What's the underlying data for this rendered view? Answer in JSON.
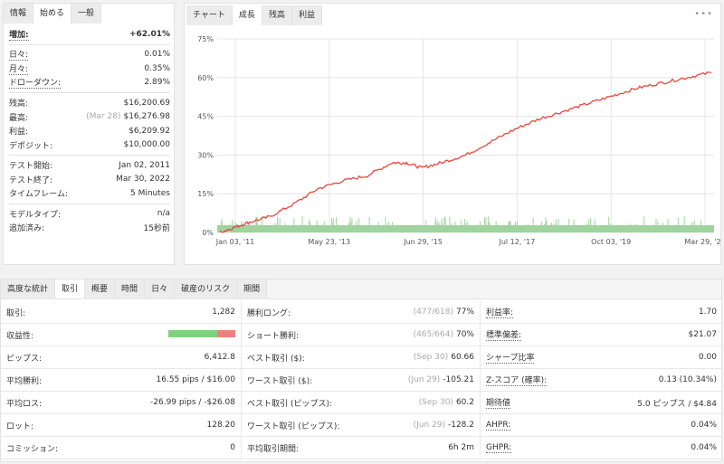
{
  "left": {
    "tabs": [
      "情報",
      "始める",
      "一般"
    ],
    "active_tab": 1,
    "rows": [
      {
        "label": "増加:",
        "value": "+62.01%",
        "green": true,
        "bold": true,
        "ul": true
      },
      {
        "sep": true
      },
      {
        "label": "日々:",
        "value": "0.01%",
        "ul": true
      },
      {
        "label": "月々:",
        "value": "0.35%",
        "ul": true
      },
      {
        "label": "ドローダウン:",
        "value": "2.89%",
        "ul": true
      },
      {
        "sep": true
      },
      {
        "label": "残高:",
        "value": "$16,200.69"
      },
      {
        "label": "最高:",
        "sub": "(Mar 28)",
        "value": "$16,276.98"
      },
      {
        "label": "利益:",
        "value": "$6,209.92",
        "green": true
      },
      {
        "label": "デポジット:",
        "value": "$10,000.00"
      },
      {
        "sep": true
      },
      {
        "label": "テスト開始:",
        "value": "Jan 02, 2011"
      },
      {
        "label": "テスト終了:",
        "value": "Mar 30, 2022"
      },
      {
        "label": "タイムフレーム:",
        "value": "5 Minutes"
      },
      {
        "sep": true
      },
      {
        "label": "モデルタイプ:",
        "value": "n/a"
      },
      {
        "label": "追加済み:",
        "value": "15秒前"
      }
    ]
  },
  "chart_panel": {
    "tabs": [
      "チャート",
      "成長",
      "残高",
      "利益"
    ],
    "active_tab": 1,
    "more": "•••"
  },
  "chart_data": {
    "type": "line",
    "ylim": [
      0,
      75
    ],
    "yticks": [
      "0%",
      "15%",
      "30%",
      "45%",
      "60%",
      "75%"
    ],
    "xticks": [
      "Jan 03, '11",
      "May 23, '13",
      "Jun 29, '15",
      "Jul 12, '17",
      "Oct 03, '19",
      "Mar 29, '22"
    ],
    "series": [
      {
        "color": "#e8473f",
        "x": [
          0,
          0.03,
          0.06,
          0.1,
          0.15,
          0.2,
          0.25,
          0.3,
          0.35,
          0.38,
          0.41,
          0.45,
          0.5,
          0.55,
          0.6,
          0.65,
          0.7,
          0.75,
          0.8,
          0.85,
          0.9,
          0.95,
          1.0
        ],
        "y": [
          0,
          2,
          4,
          6,
          11,
          17,
          20,
          22,
          27,
          27,
          25,
          27,
          30,
          35,
          40,
          44,
          47,
          50,
          53,
          56,
          58,
          60,
          62
        ]
      }
    ],
    "volume_color": "#9fd49f",
    "grid": true
  },
  "bottom": {
    "tabs": [
      "高度な統計",
      "取引",
      "概要",
      "時間",
      "日々",
      "破産のリスク",
      "期間"
    ],
    "active_tab": 1,
    "rows": [
      [
        {
          "label": "取引:",
          "value": "1,282"
        },
        {
          "label": "勝利ロング:",
          "sub": "(477/618)",
          "value": "77%"
        },
        {
          "label": "利益率:",
          "value": "1.70",
          "ul": true
        }
      ],
      [
        {
          "label": "収益性:",
          "bar": true
        },
        {
          "label": "ショート勝利:",
          "sub": "(465/664)",
          "value": "70%"
        },
        {
          "label": "標準偏差:",
          "value": "$21.07",
          "ul": true
        }
      ],
      [
        {
          "label": "ピップス:",
          "value": "6,412.8"
        },
        {
          "label": "ベスト取引 ($):",
          "sub": "(Sep 30)",
          "value": "60.66"
        },
        {
          "label": "シャープ比率",
          "value": "0.00",
          "ul": true
        }
      ],
      [
        {
          "label": "平均勝利:",
          "value": "16.55 pips / $16.00"
        },
        {
          "label": "ワースト取引 ($):",
          "sub": "(Jun 29)",
          "value": "-105.21"
        },
        {
          "label": "Z-スコア (確率):",
          "value": "0.13 (10.34%)",
          "ul": true
        }
      ],
      [
        {
          "label": "平均ロス:",
          "value": "-26.99 pips / -$26.08"
        },
        {
          "label": "ベスト取引 (ピップス):",
          "sub": "(Sep 30)",
          "value": "60.2"
        },
        {
          "label": "期待値",
          "value": "5.0 ピップス / $4.84",
          "ul": true
        }
      ],
      [
        {
          "label": "ロット:",
          "value": "128.20"
        },
        {
          "label": "ワースト取引 (ピップス):",
          "sub": "(Jun 29)",
          "value": "-128.2"
        },
        {
          "label": "AHPR:",
          "value": "0.04%",
          "ul": true
        }
      ],
      [
        {
          "label": "コミッション:",
          "value": "0"
        },
        {
          "label": "平均取引期間:",
          "value": "6h 2m"
        },
        {
          "label": "GHPR:",
          "value": "0.04%",
          "ul": true
        }
      ]
    ],
    "profitability": {
      "win_fraction": 0.73
    }
  }
}
